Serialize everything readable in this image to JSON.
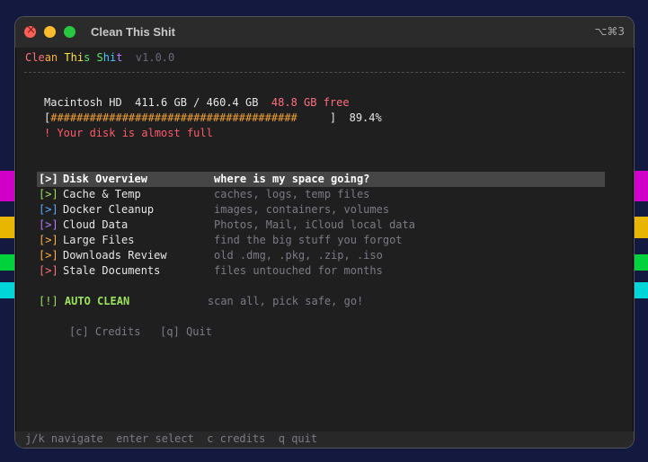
{
  "window": {
    "title": "Clean This Shit",
    "shortcut": "⌥⌘3"
  },
  "app": {
    "name_parts": [
      "Cle",
      "an ",
      "Thi",
      "s S",
      "hi",
      "t"
    ],
    "version": "v1.0.0"
  },
  "disk": {
    "name": "Macintosh HD",
    "used": "411.6 GB",
    "total": "460.4 GB",
    "free": "48.8 GB free",
    "bar_fill": "######################################",
    "bar_empty": "     ",
    "percent": "89.4%",
    "percent_value": 89.4,
    "warning": "! Your disk is almost full"
  },
  "menu": [
    {
      "bracket": "[>]",
      "label": "Disk Overview",
      "desc": "where is my space going?",
      "color": "#ffffff",
      "selected": true
    },
    {
      "bracket": "[>]",
      "label": "Cache & Temp",
      "desc": "caches, logs, temp files",
      "color": "#9be35a"
    },
    {
      "bracket": "[>]",
      "label": "Docker Cleanup",
      "desc": "images, containers, volumes",
      "color": "#5aa9ff"
    },
    {
      "bracket": "[>]",
      "label": "Cloud Data",
      "desc": "Photos, Mail, iCloud local data",
      "color": "#b67bff"
    },
    {
      "bracket": "[>]",
      "label": "Large Files",
      "desc": "find the big stuff you forgot",
      "color": "#ffb13d"
    },
    {
      "bracket": "[>]",
      "label": "Downloads Review",
      "desc": "old .dmg, .pkg, .zip, .iso",
      "color": "#ffb13d"
    },
    {
      "bracket": "[>]",
      "label": "Stale Documents",
      "desc": "files untouched for months",
      "color": "#ff6f7f"
    }
  ],
  "auto_clean": {
    "bracket": "[!]",
    "label": "AUTO CLEAN",
    "desc": "scan all, pick safe, go!"
  },
  "links": {
    "credits": "[c] Credits",
    "quit": "[q] Quit"
  },
  "footer": {
    "hint": "j/k navigate  enter select  c credits  q quit"
  },
  "colors": {
    "accent": "#9be35a",
    "warning": "#ff5a6a",
    "bar": "#f0a03a"
  }
}
